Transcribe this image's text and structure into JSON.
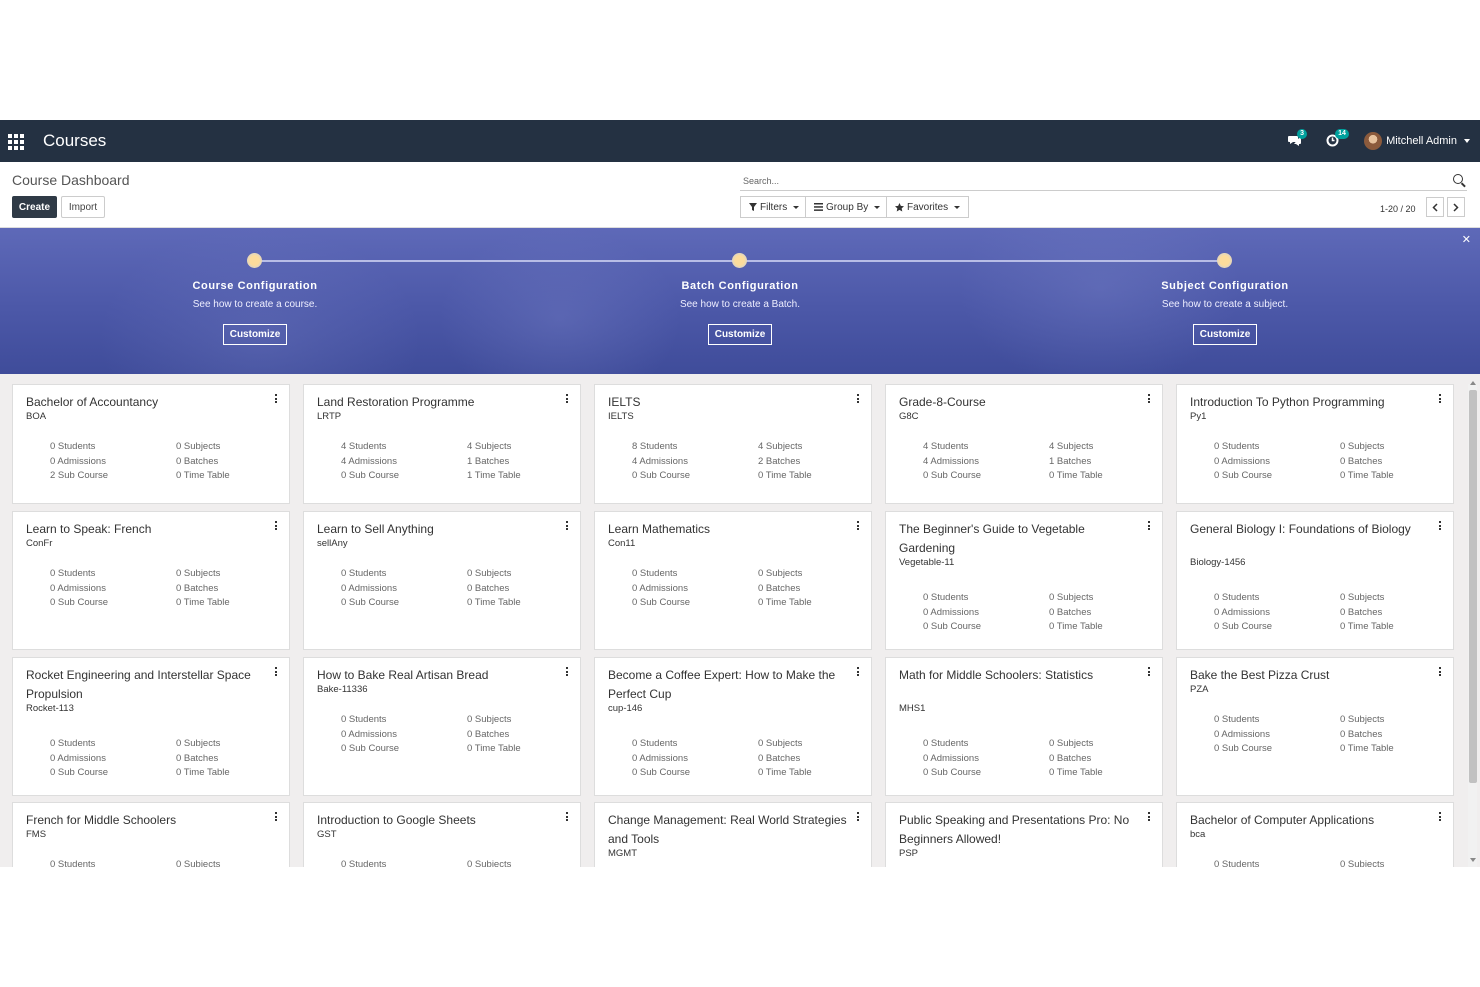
{
  "navbar": {
    "title": "Courses",
    "messages_badge": "3",
    "activities_badge": "14",
    "user_name": "Mitchell Admin"
  },
  "control": {
    "breadcrumb": "Course Dashboard",
    "create_label": "Create",
    "import_label": "Import",
    "search_placeholder": "Search...",
    "filters_label": "Filters",
    "groupby_label": "Group By",
    "favorites_label": "Favorites",
    "pager": "1-20 / 20"
  },
  "banner": {
    "steps": [
      {
        "title": "Course Configuration",
        "subtitle": "See how to create a course.",
        "button": "Customize"
      },
      {
        "title": "Batch Configuration",
        "subtitle": "See how to create a Batch.",
        "button": "Customize"
      },
      {
        "title": "Subject Configuration",
        "subtitle": "See how to create a subject.",
        "button": "Customize"
      }
    ]
  },
  "cards": [
    {
      "name": "Bachelor of Accountancy",
      "code": "BOA",
      "stats": [
        "0 Students",
        "0 Subjects",
        "0 Admissions",
        "0 Batches",
        "2 Sub Course",
        "0 Time Table"
      ]
    },
    {
      "name": "Land Restoration Programme",
      "code": "LRTP",
      "stats": [
        "4 Students",
        "4 Subjects",
        "4 Admissions",
        "1 Batches",
        "0 Sub Course",
        "1 Time Table"
      ]
    },
    {
      "name": "IELTS",
      "code": "IELTS",
      "stats": [
        "8 Students",
        "4 Subjects",
        "4 Admissions",
        "2 Batches",
        "0 Sub Course",
        "0 Time Table"
      ]
    },
    {
      "name": "Grade-8-Course",
      "code": "G8C",
      "stats": [
        "4 Students",
        "4 Subjects",
        "4 Admissions",
        "1 Batches",
        "0 Sub Course",
        "0 Time Table"
      ]
    },
    {
      "name": "Introduction To Python Programming",
      "code": "Py1",
      "stats": [
        "0 Students",
        "0 Subjects",
        "0 Admissions",
        "0 Batches",
        "0 Sub Course",
        "0 Time Table"
      ]
    },
    {
      "name": "Learn to Speak: French",
      "code": "ConFr",
      "stats": [
        "0 Students",
        "0 Subjects",
        "0 Admissions",
        "0 Batches",
        "0 Sub Course",
        "0 Time Table"
      ]
    },
    {
      "name": "Learn to Sell Anything",
      "code": "sellAny",
      "stats": [
        "0 Students",
        "0 Subjects",
        "0 Admissions",
        "0 Batches",
        "0 Sub Course",
        "0 Time Table"
      ]
    },
    {
      "name": "Learn Mathematics",
      "code": "Con11",
      "stats": [
        "0 Students",
        "0 Subjects",
        "0 Admissions",
        "0 Batches",
        "0 Sub Course",
        "0 Time Table"
      ]
    },
    {
      "name": "The Beginner's Guide to Vegetable Gardening",
      "code": "Vegetable-11",
      "stats": [
        "0 Students",
        "0 Subjects",
        "0 Admissions",
        "0 Batches",
        "0 Sub Course",
        "0 Time Table"
      ]
    },
    {
      "name": "General Biology I: Foundations of Biology",
      "code": "Biology-1456",
      "stats": [
        "0 Students",
        "0 Subjects",
        "0 Admissions",
        "0 Batches",
        "0 Sub Course",
        "0 Time Table"
      ]
    },
    {
      "name": "Rocket Engineering and Interstellar Space Propulsion",
      "code": "Rocket-113",
      "stats": [
        "0 Students",
        "0 Subjects",
        "0 Admissions",
        "0 Batches",
        "0 Sub Course",
        "0 Time Table"
      ]
    },
    {
      "name": "How to Bake Real Artisan Bread",
      "code": "Bake-11336",
      "stats": [
        "0 Students",
        "0 Subjects",
        "0 Admissions",
        "0 Batches",
        "0 Sub Course",
        "0 Time Table"
      ]
    },
    {
      "name": "Become a Coffee Expert: How to Make the Perfect Cup",
      "code": "cup-146",
      "stats": [
        "0 Students",
        "0 Subjects",
        "0 Admissions",
        "0 Batches",
        "0 Sub Course",
        "0 Time Table"
      ]
    },
    {
      "name": "Math for Middle Schoolers: Statistics",
      "code": "MHS1",
      "stats": [
        "0 Students",
        "0 Subjects",
        "0 Admissions",
        "0 Batches",
        "0 Sub Course",
        "0 Time Table"
      ]
    },
    {
      "name": "Bake the Best Pizza Crust",
      "code": "PZA",
      "stats": [
        "0 Students",
        "0 Subjects",
        "0 Admissions",
        "0 Batches",
        "0 Sub Course",
        "0 Time Table"
      ]
    },
    {
      "name": "French for Middle Schoolers",
      "code": "FMS",
      "stats": [
        "0 Students",
        "0 Subjects"
      ]
    },
    {
      "name": "Introduction to Google Sheets",
      "code": "GST",
      "stats": [
        "0 Students",
        "0 Subjects"
      ]
    },
    {
      "name": "Change Management: Real World Strategies and Tools",
      "code": "MGMT",
      "stats": []
    },
    {
      "name": "Public Speaking and Presentations Pro: No Beginners Allowed!",
      "code": "PSP",
      "stats": []
    },
    {
      "name": "Bachelor of Computer Applications",
      "code": "bca",
      "stats": [
        "0 Students",
        "0 Subjects"
      ]
    }
  ],
  "colors": {
    "navbar": "#243142",
    "primary_button": "#2f3a46",
    "banner": "#4c58a8",
    "badge": "#00a09d"
  }
}
